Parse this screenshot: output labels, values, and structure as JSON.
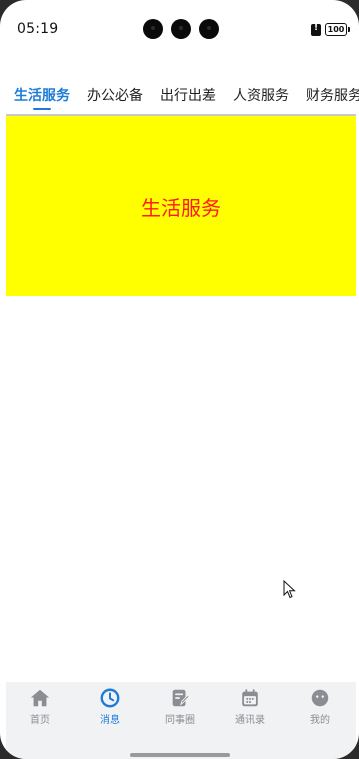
{
  "status_bar": {
    "time": "05:19",
    "battery": "100"
  },
  "tabs": [
    {
      "label": "生活服务",
      "active": true
    },
    {
      "label": "办公必备",
      "active": false
    },
    {
      "label": "出行出差",
      "active": false
    },
    {
      "label": "人资服务",
      "active": false
    },
    {
      "label": "财务服务",
      "active": false
    }
  ],
  "panel": {
    "title": "生活服务",
    "background": "#ffff00",
    "text_color": "#ff1a1a"
  },
  "bottom_nav": [
    {
      "label": "首页",
      "icon": "home-icon",
      "active": false
    },
    {
      "label": "消息",
      "icon": "clock-icon",
      "active": true
    },
    {
      "label": "同事圈",
      "icon": "edit-icon",
      "active": false
    },
    {
      "label": "通讯录",
      "icon": "calendar-icon",
      "active": false
    },
    {
      "label": "我的",
      "icon": "profile-icon",
      "active": false
    }
  ],
  "colors": {
    "accent": "#1e7bd8",
    "nav_inactive": "#8b8d93"
  }
}
